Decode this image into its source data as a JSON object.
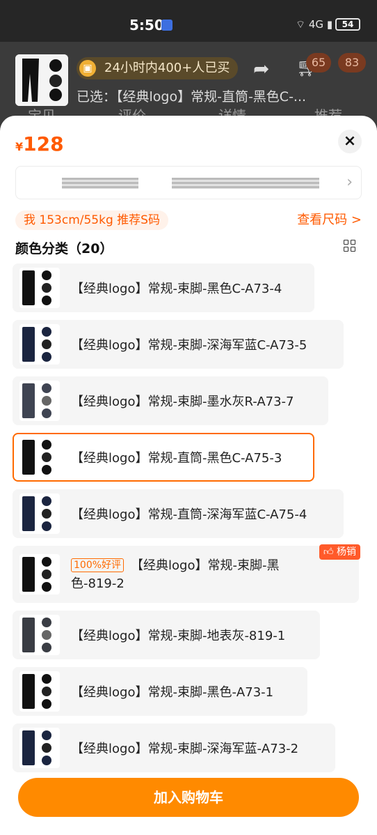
{
  "status_bar": {
    "time": "5:50",
    "signal": "4G",
    "battery": "54"
  },
  "header": {
    "sold_badge": "24小时内400+人已买",
    "selected_text": "已选：【经典logo】常规-直筒-黑色C-...",
    "cart_count_1": "65",
    "cart_count_2": "83",
    "dim_tabs": [
      "宝贝",
      "评价",
      "详情",
      "推荐"
    ]
  },
  "sheet": {
    "price_currency": "¥",
    "price_value": "128",
    "close_label": "×",
    "size_recommendation": "我 153cm/55kg 推荐S码",
    "size_chart_link": "查看尺码 >",
    "category_title": "颜色分类（20）",
    "options": [
      {
        "label": "【经典logo】常规-束脚-黑色C-A73-4",
        "color": "#111111",
        "selected": false
      },
      {
        "label": "【经典logo】常规-束脚-深海军蓝C-A73-5",
        "color": "#1b2540",
        "selected": false
      },
      {
        "label": "【经典logo】常规-束脚-墨水灰R-A73-7",
        "color": "#3f4452",
        "selected": false
      },
      {
        "label": "【经典logo】常规-直筒-黑色C-A75-3",
        "color": "#111111",
        "selected": true
      },
      {
        "label": "【经典logo】常规-直筒-深海军蓝C-A75-4",
        "color": "#1b2540",
        "selected": false
      },
      {
        "tag": "100%好评",
        "label": "【经典logo】常规-束脚-黑色-819-2",
        "color": "#111111",
        "selected": false,
        "hot": "杨销"
      },
      {
        "label": "【经典logo】常规-束脚-地表灰-819-1",
        "color": "#3a3d44",
        "selected": false
      },
      {
        "label": "【经典logo】常规-束脚-黑色-A73-1",
        "color": "#111111",
        "selected": false
      },
      {
        "label": "【经典logo】常规-束脚-深海军蓝-A73-2",
        "color": "#1b2540",
        "selected": false
      }
    ],
    "add_to_cart": "加入购物车"
  },
  "colors": {
    "accent": "#ff6a00",
    "button": "#ff8a00"
  }
}
